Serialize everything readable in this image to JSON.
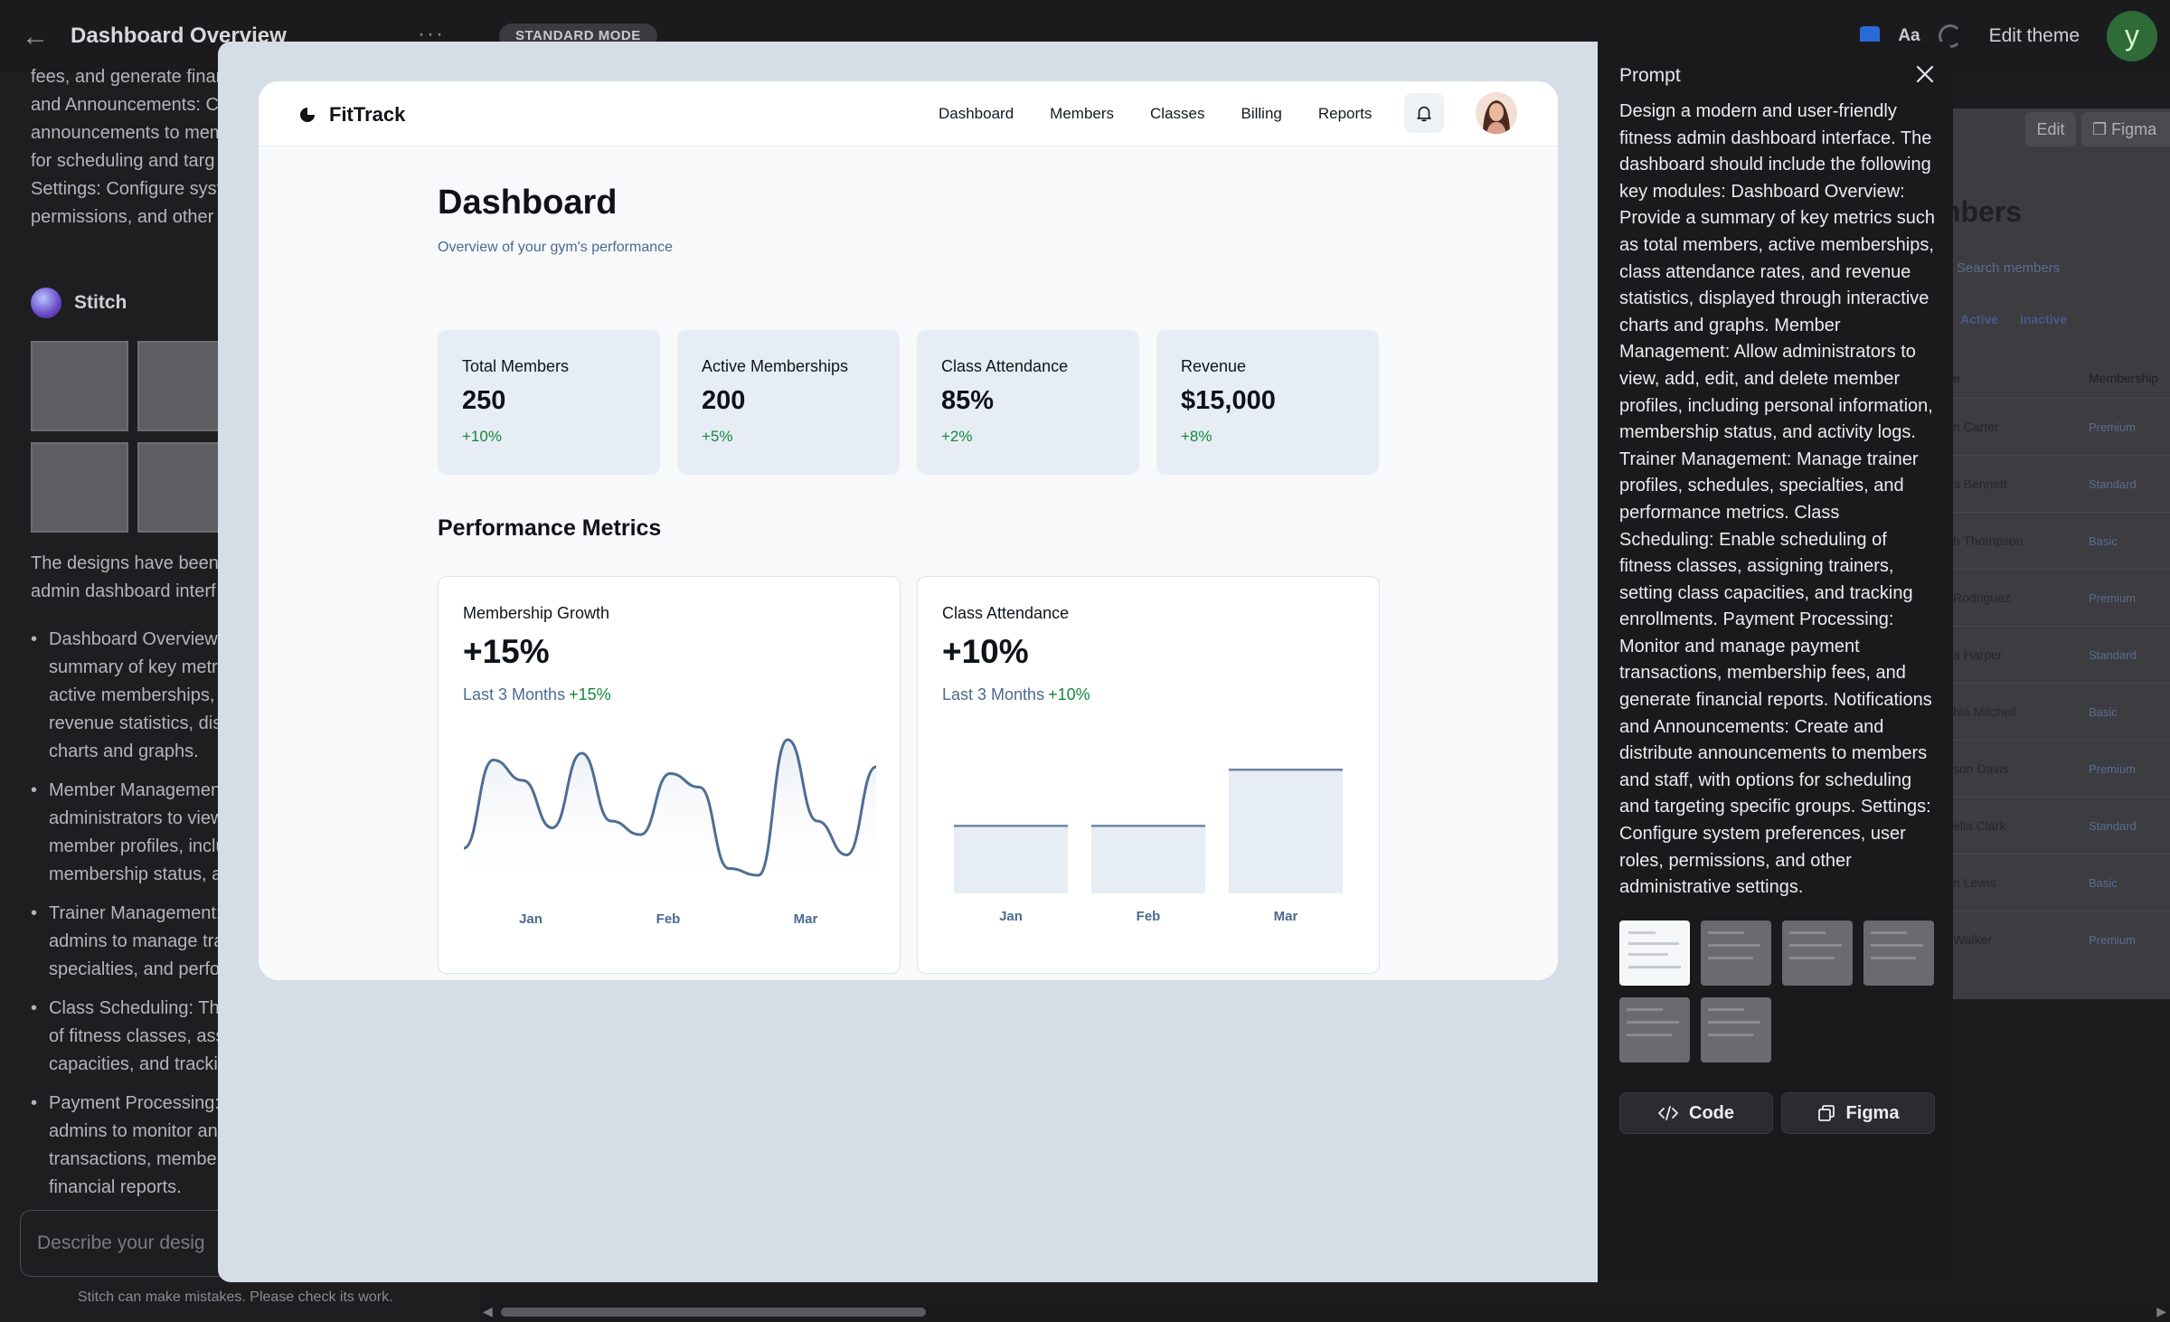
{
  "window": {
    "title": "Dashboard Overview",
    "mode_badge": "STANDARD MODE",
    "font_control": "Aa",
    "edit_theme": "Edit theme",
    "user_initial": "y"
  },
  "chat": {
    "intro_lines": [
      "fees, and generate finar",
      "and Announcements: Cr",
      "announcements to mem",
      "for scheduling and targ",
      "Settings: Configure syst",
      "permissions, and other a"
    ],
    "assistant_name": "Stitch",
    "summary_lines": [
      "The designs have been g",
      "admin dashboard interf"
    ],
    "bullets": [
      [
        "Dashboard Overview:",
        "summary of key metr",
        "active memberships,",
        "revenue statistics, disp",
        "charts and graphs."
      ],
      [
        "Member Managemen",
        "administrators to view",
        "member profiles, inclu",
        "membership status, a"
      ],
      [
        "Trainer Management:",
        "admins to manage tra",
        "specialties, and perfo"
      ],
      [
        "Class Scheduling: This",
        "of fitness classes, assi",
        "capacities, and trackin"
      ],
      [
        "Payment Processing: T",
        "admins to monitor an",
        "transactions, member",
        "financial reports."
      ]
    ],
    "input_placeholder": "Describe your desig",
    "disclaimer": "Stitch can make mistakes. Please check its work."
  },
  "background_canvas": {
    "edit_label": "Edit",
    "figma_label": "Figma",
    "members_title": "mbers",
    "search_placeholder": "Search members",
    "filters": [
      "Active",
      "Inactive"
    ],
    "columns": [
      "e",
      "Membership"
    ],
    "rows": [
      {
        "name": "n Carter",
        "tier": "Premium"
      },
      {
        "name": "a Bennett",
        "tier": "Standard"
      },
      {
        "name": "h Thompson",
        "tier": "Basic"
      },
      {
        "name": "Rodriguez",
        "tier": "Premium"
      },
      {
        "name": "a Harper",
        "tier": "Standard"
      },
      {
        "name": "hia Mitchell",
        "tier": "Basic"
      },
      {
        "name": "son Davis",
        "tier": "Premium"
      },
      {
        "name": "ella Clark",
        "tier": "Standard"
      },
      {
        "name": "n Lewis",
        "tier": "Basic"
      },
      {
        "name": "Walker",
        "tier": "Premium"
      }
    ]
  },
  "app": {
    "brand": "FitTrack",
    "nav": [
      "Dashboard",
      "Members",
      "Classes",
      "Billing",
      "Reports"
    ],
    "page_title": "Dashboard",
    "page_subtitle": "Overview of your gym's performance",
    "stats": [
      {
        "label": "Total Members",
        "value": "250",
        "delta": "+10%"
      },
      {
        "label": "Active Memberships",
        "value": "200",
        "delta": "+5%"
      },
      {
        "label": "Class Attendance",
        "value": "85%",
        "delta": "+2%"
      },
      {
        "label": "Revenue",
        "value": "$15,000",
        "delta": "+8%"
      }
    ],
    "section_title": "Performance Metrics",
    "charts": [
      {
        "label": "Membership Growth",
        "value": "+15%",
        "period": "Last 3 Months",
        "period_delta": "+15%"
      },
      {
        "label": "Class Attendance",
        "value": "+10%",
        "period": "Last 3 Months",
        "period_delta": "+10%"
      }
    ]
  },
  "chart_data": [
    {
      "type": "line",
      "title": "Membership Growth",
      "categories": [
        "Jan",
        "Feb",
        "Mar"
      ],
      "values": [
        0.2,
        0.85,
        0.7,
        0.35,
        0.9,
        0.4,
        0.3,
        0.75,
        0.65,
        0.05,
        0.0,
        1.0,
        0.4,
        0.15,
        0.8
      ],
      "grid": false,
      "color": "#4d6e93"
    },
    {
      "type": "bar",
      "title": "Class Attendance",
      "categories": [
        "Jan",
        "Feb",
        "Mar"
      ],
      "values": [
        55,
        55,
        100
      ],
      "ylim": [
        0,
        100
      ],
      "grid": false,
      "color": "#e7edf4"
    }
  ],
  "prompt": {
    "title": "Prompt",
    "text": "Design a modern and user-friendly fitness admin dashboard interface. The dashboard should include the following key modules: Dashboard Overview: Provide a summary of key metrics such as total members, active memberships, class attendance rates, and revenue statistics, displayed through interactive charts and graphs. Member Management: Allow administrators to view, add, edit, and delete member profiles, including personal information, membership status, and activity logs. Trainer Management: Manage trainer profiles, schedules, specialties, and performance metrics. Class Scheduling: Enable scheduling of fitness classes, assigning trainers, setting class capacities, and tracking enrollments. Payment Processing: Monitor and manage payment transactions, membership fees, and generate financial reports. Notifications and Announcements: Create and distribute announcements to members and staff, with options for scheduling and targeting specific groups. Settings: Configure system preferences, user roles, permissions, and other administrative settings.",
    "code_label": "Code",
    "figma_label": "Figma"
  },
  "colors": {
    "accent_green": "#14873d",
    "muted_blue": "#4b6a8f",
    "card_bg": "#e7edf4",
    "line": "#4d6e93"
  }
}
